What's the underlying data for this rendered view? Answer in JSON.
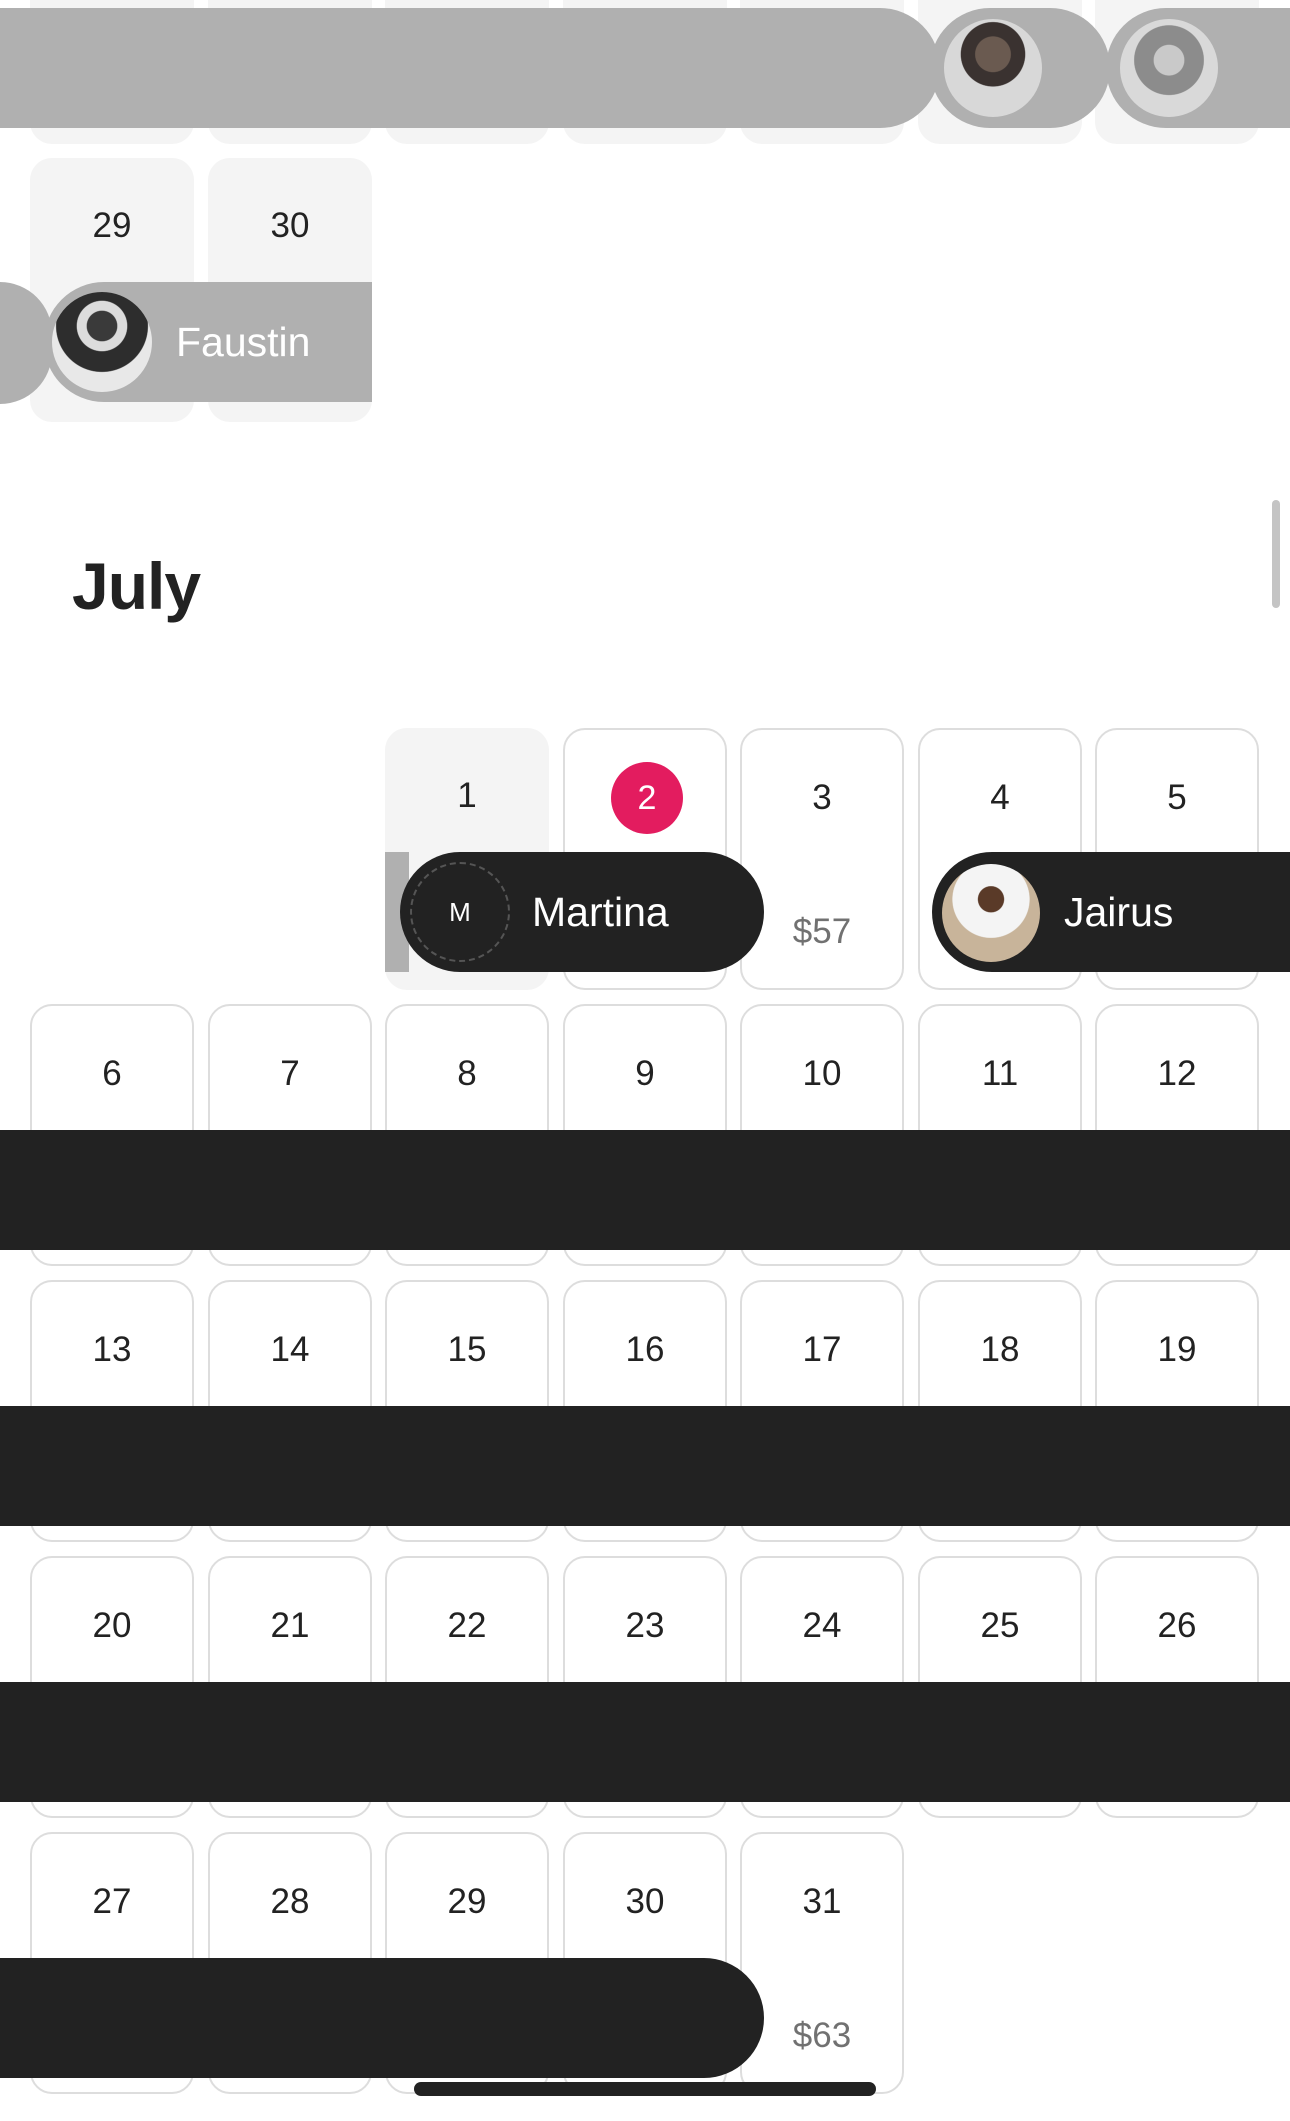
{
  "previous_month": {
    "days": [
      "29",
      "30"
    ],
    "reservations": [
      {
        "guest": "Faustin"
      }
    ]
  },
  "month": {
    "title": "July",
    "today": "2",
    "days": [
      "1",
      "2",
      "3",
      "4",
      "5",
      "6",
      "7",
      "8",
      "9",
      "10",
      "11",
      "12",
      "13",
      "14",
      "15",
      "16",
      "17",
      "18",
      "19",
      "20",
      "21",
      "22",
      "23",
      "24",
      "25",
      "26",
      "27",
      "28",
      "29",
      "30",
      "31"
    ],
    "prices": {
      "day_3": "$57",
      "day_31": "$63"
    },
    "reservations": [
      {
        "guest": "Martina",
        "avatar_initial": "M"
      },
      {
        "guest": "Jairus"
      }
    ]
  },
  "colors": {
    "accent": "#e31c5f",
    "booking_bar": "#222222",
    "past_booking_bar": "#b0b0b0",
    "price_text": "#717171"
  },
  "icons": {
    "guest_avatar": "person-photo-icon"
  }
}
